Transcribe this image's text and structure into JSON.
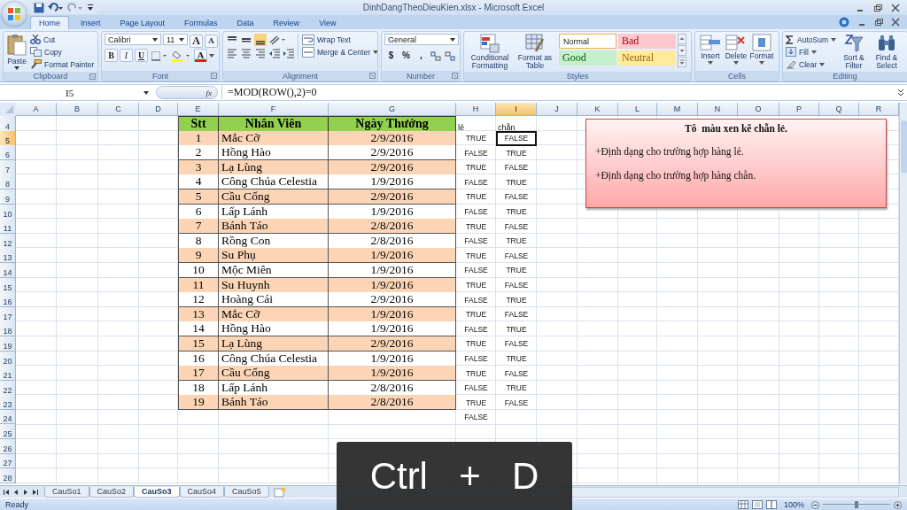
{
  "window": {
    "title": "DinhDangTheoDieuKien.xlsx - Microsoft Excel"
  },
  "tabs": [
    {
      "label": "Home",
      "selected": true
    },
    {
      "label": "Insert",
      "selected": false
    },
    {
      "label": "Page Layout",
      "selected": false
    },
    {
      "label": "Formulas",
      "selected": false
    },
    {
      "label": "Data",
      "selected": false
    },
    {
      "label": "Review",
      "selected": false
    },
    {
      "label": "View",
      "selected": false
    }
  ],
  "clipboard": {
    "title": "Clipboard",
    "paste": "Paste",
    "cut": "Cut",
    "copy": "Copy",
    "format_painter": "Format Painter"
  },
  "font": {
    "title": "Font",
    "family": "Calibri",
    "size": "11",
    "grow": "A",
    "shrink": "A",
    "bold": "B",
    "italic": "I",
    "underline": "U",
    "font_color": "A"
  },
  "alignment": {
    "title": "Alignment",
    "wrap_text": "Wrap Text",
    "merge_center": "Merge & Center"
  },
  "number": {
    "title": "Number",
    "format": "General",
    "currency": "$",
    "percent": "%",
    "comma": ","
  },
  "styles": {
    "title": "Styles",
    "conditional_formatting": "Conditional Formatting",
    "format_as_table": "Format as Table",
    "cell_styles": [
      {
        "label": "Normal",
        "kind": "normal"
      },
      {
        "label": "Bad",
        "kind": "bad"
      },
      {
        "label": "Good",
        "kind": "good"
      },
      {
        "label": "Neutral",
        "kind": "neutral"
      }
    ]
  },
  "cells": {
    "title": "Cells",
    "insert": "Insert",
    "delete": "Delete",
    "format": "Format"
  },
  "editing": {
    "title": "Editing",
    "autosum": "AutoSum",
    "fill": "Fill",
    "clear": "Clear",
    "sort_filter": "Sort & Filter",
    "find_select": "Find & Select"
  },
  "formula_bar": {
    "name_box": "I5",
    "function_label": "fx",
    "formula": "=MOD(ROW(),2)=0"
  },
  "sheet": {
    "columns": [
      {
        "label": "A",
        "selected": false
      },
      {
        "label": "B",
        "selected": false
      },
      {
        "label": "C",
        "selected": false
      },
      {
        "label": "D",
        "selected": false
      },
      {
        "label": "E",
        "selected": false
      },
      {
        "label": "F",
        "selected": false
      },
      {
        "label": "G",
        "selected": false
      },
      {
        "label": "H",
        "selected": false
      },
      {
        "label": "I",
        "selected": true
      },
      {
        "label": "J",
        "selected": false
      },
      {
        "label": "K",
        "selected": false
      },
      {
        "label": "L",
        "selected": false
      },
      {
        "label": "M",
        "selected": false
      },
      {
        "label": "N",
        "selected": false
      },
      {
        "label": "O",
        "selected": false
      },
      {
        "label": "P",
        "selected": false
      },
      {
        "label": "Q",
        "selected": false
      },
      {
        "label": "R",
        "selected": false
      }
    ],
    "header": {
      "row": "4",
      "stt": "Stt",
      "name": "Nhân Viên",
      "date": "Ngày Thưởng",
      "odd": "lẻ",
      "even": "chẵn"
    },
    "records": [
      {
        "row": "5",
        "stt": "1",
        "name": "Mắc Cỡ",
        "date": "2/9/2016",
        "odd": "TRUE",
        "even": "FALSE",
        "shaded": true,
        "selected": true
      },
      {
        "row": "6",
        "stt": "2",
        "name": "Hồng Hào",
        "date": "2/9/2016",
        "odd": "FALSE",
        "even": "TRUE",
        "shaded": false,
        "selected": false
      },
      {
        "row": "7",
        "stt": "3",
        "name": "Lạ Lùng",
        "date": "2/9/2016",
        "odd": "TRUE",
        "even": "FALSE",
        "shaded": true,
        "selected": false
      },
      {
        "row": "8",
        "stt": "4",
        "name": "Công Chúa Celestia",
        "date": "1/9/2016",
        "odd": "FALSE",
        "even": "TRUE",
        "shaded": false,
        "selected": false
      },
      {
        "row": "9",
        "stt": "5",
        "name": "Cầu Cống",
        "date": "2/9/2016",
        "odd": "TRUE",
        "even": "FALSE",
        "shaded": true,
        "selected": false
      },
      {
        "row": "10",
        "stt": "6",
        "name": "Lấp Lánh",
        "date": "1/9/2016",
        "odd": "FALSE",
        "even": "TRUE",
        "shaded": false,
        "selected": false
      },
      {
        "row": "11",
        "stt": "7",
        "name": "Bánh Táo",
        "date": "2/8/2016",
        "odd": "TRUE",
        "even": "FALSE",
        "shaded": true,
        "selected": false
      },
      {
        "row": "12",
        "stt": "8",
        "name": "Rồng Con",
        "date": "2/8/2016",
        "odd": "FALSE",
        "even": "TRUE",
        "shaded": false,
        "selected": false
      },
      {
        "row": "13",
        "stt": "9",
        "name": "Su Phụ",
        "date": "1/9/2016",
        "odd": "TRUE",
        "even": "FALSE",
        "shaded": true,
        "selected": false
      },
      {
        "row": "14",
        "stt": "10",
        "name": "Mộc Miên",
        "date": "1/9/2016",
        "odd": "FALSE",
        "even": "TRUE",
        "shaded": false,
        "selected": false
      },
      {
        "row": "15",
        "stt": "11",
        "name": "Su Huynh",
        "date": "1/9/2016",
        "odd": "TRUE",
        "even": "FALSE",
        "shaded": true,
        "selected": false
      },
      {
        "row": "16",
        "stt": "12",
        "name": "Hoàng Cái",
        "date": "2/9/2016",
        "odd": "FALSE",
        "even": "TRUE",
        "shaded": false,
        "selected": false
      },
      {
        "row": "17",
        "stt": "13",
        "name": "Mắc Cỡ",
        "date": "1/9/2016",
        "odd": "TRUE",
        "even": "FALSE",
        "shaded": true,
        "selected": false
      },
      {
        "row": "18",
        "stt": "14",
        "name": "Hồng Hào",
        "date": "1/9/2016",
        "odd": "FALSE",
        "even": "TRUE",
        "shaded": false,
        "selected": false
      },
      {
        "row": "19",
        "stt": "15",
        "name": "Lạ Lùng",
        "date": "2/9/2016",
        "odd": "TRUE",
        "even": "FALSE",
        "shaded": true,
        "selected": false
      },
      {
        "row": "20",
        "stt": "16",
        "name": "Công Chúa Celestia",
        "date": "1/9/2016",
        "odd": "FALSE",
        "even": "TRUE",
        "shaded": false,
        "selected": false
      },
      {
        "row": "21",
        "stt": "17",
        "name": "Cầu Cống",
        "date": "1/9/2016",
        "odd": "TRUE",
        "even": "FALSE",
        "shaded": true,
        "selected": false
      },
      {
        "row": "22",
        "stt": "18",
        "name": "Lấp Lánh",
        "date": "2/8/2016",
        "odd": "FALSE",
        "even": "TRUE",
        "shaded": false,
        "selected": false
      },
      {
        "row": "23",
        "stt": "19",
        "name": "Bánh Táo",
        "date": "2/8/2016",
        "odd": "TRUE",
        "even": "FALSE",
        "shaded": true,
        "selected": false
      }
    ],
    "extra_rows": [
      {
        "row": "24",
        "odd": "FALSE"
      },
      {
        "row": "25"
      },
      {
        "row": "26"
      },
      {
        "row": "27"
      },
      {
        "row": "28"
      }
    ]
  },
  "note": {
    "title": "Tô  màu xen kẽ chẵn lẻ.",
    "lines": [
      "+Định dạng cho trường hợp hàng lẻ.",
      "+Định dạng cho trường hợp hàng chẵn."
    ]
  },
  "sheet_tabs": [
    {
      "label": "CauSo1",
      "selected": false
    },
    {
      "label": "CauSo2",
      "selected": false
    },
    {
      "label": "CauSo3",
      "selected": true
    },
    {
      "label": "CauSo4",
      "selected": false
    },
    {
      "label": "CauSo5",
      "selected": false
    }
  ],
  "status_bar": {
    "status": "Ready",
    "zoom": "100%",
    "zoom_slider": {
      "level": 0.5
    }
  },
  "keystroke": {
    "keys": [
      "Ctrl",
      "+",
      "D"
    ]
  }
}
